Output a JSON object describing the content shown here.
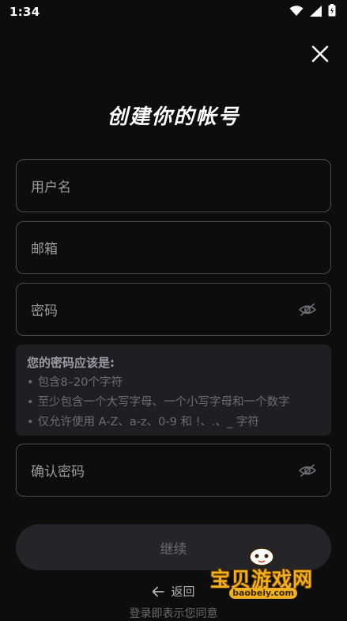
{
  "status_bar": {
    "time": "1:34"
  },
  "title": "创建你的帐号",
  "fields": {
    "username": {
      "placeholder": "用户名"
    },
    "email": {
      "placeholder": "邮箱"
    },
    "password": {
      "placeholder": "密码"
    },
    "confirm_password": {
      "placeholder": "确认密码"
    }
  },
  "password_rules": {
    "title": "您的密码应该是:",
    "items": [
      "包含8–20个字符",
      "至少包含一个大写字母、一个小写字母和一个数字",
      "仅允许使用 A-Z、a-z、0-9 和 !、.、_ 字符"
    ]
  },
  "continue_label": "继续",
  "back_label": "返回",
  "agree_text": "登录即表示您同意",
  "watermark": {
    "text": "宝贝游戏网",
    "sub": "baobeiy.com"
  }
}
